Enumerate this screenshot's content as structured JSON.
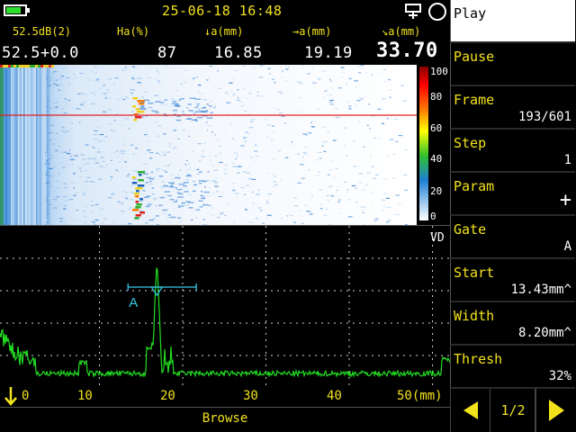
{
  "status": {
    "datetime": "25-06-18 16:48",
    "battery_color": "#2ee02e"
  },
  "measurements": {
    "gain": {
      "label": "52.5dB(2)",
      "value": "52.5+0.0"
    },
    "ha": {
      "label": "Ha(%)",
      "value": "87"
    },
    "depth": {
      "label": "↓a(mm)",
      "value": "16.85"
    },
    "surface": {
      "label": "→a(mm)",
      "value": "19.19"
    },
    "path": {
      "label": "↘a(mm)",
      "value": "33.70"
    }
  },
  "colorbar": {
    "ticks": [
      "100",
      "80",
      "60",
      "40",
      "20",
      "0"
    ]
  },
  "ascan": {
    "vd_label": "VD",
    "gate_label": "A",
    "x_ticks": [
      "0",
      "10",
      "20",
      "30",
      "40",
      "50(mm)"
    ],
    "gate": {
      "start_mm": 13.43,
      "width_mm": 8.2,
      "threshold_pct": 32
    },
    "peak": {
      "position_mm": 16.9,
      "amplitude_pct": 87
    }
  },
  "mode": "Browse",
  "menu": [
    {
      "label": "Play",
      "value": "",
      "active": true
    },
    {
      "label": "Pause",
      "value": ""
    },
    {
      "label": "Frame",
      "value": "193/601"
    },
    {
      "label": "Step",
      "value": "1"
    },
    {
      "label": "Param",
      "value": "+"
    },
    {
      "label": "Gate",
      "value": "A"
    },
    {
      "label": "Start",
      "value": "13.43mm^"
    },
    {
      "label": "Width",
      "value": "8.20mm^"
    },
    {
      "label": "Thresh",
      "value": "32%"
    }
  ],
  "nav": {
    "page": "1/2"
  },
  "colors": {
    "accent": "#f2e21c",
    "signal": "#22dd22",
    "gate": "#35c9e6",
    "cursor": "#e02020"
  }
}
